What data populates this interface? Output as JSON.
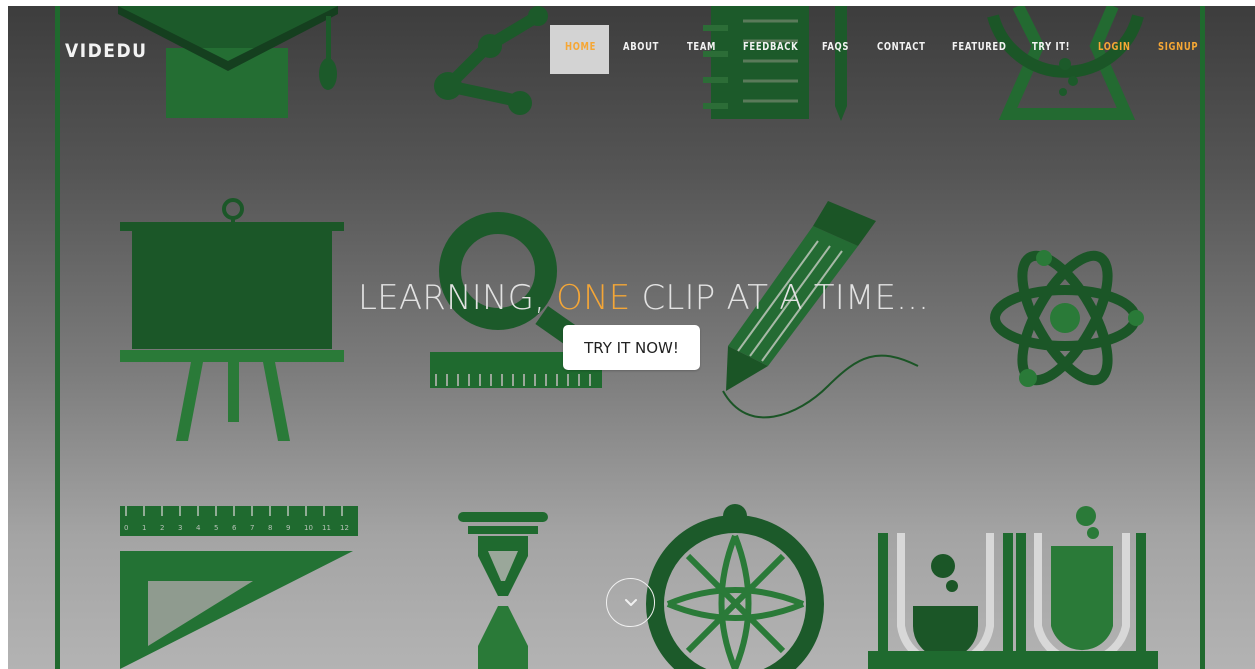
{
  "brand": {
    "name": "VIDEDU"
  },
  "nav": {
    "items": [
      {
        "label": "HOME",
        "active": true
      },
      {
        "label": "ABOUT"
      },
      {
        "label": "TEAM"
      },
      {
        "label": "FEEDBACK"
      },
      {
        "label": "FAQS"
      },
      {
        "label": "CONTACT"
      },
      {
        "label": "FEATURED"
      },
      {
        "label": "TRY IT!"
      },
      {
        "label": "LOGIN",
        "accent": true
      },
      {
        "label": "SIGNUP",
        "accent": true
      }
    ]
  },
  "hero": {
    "headline_pre": "LEARNING, ",
    "headline_highlight": "ONE",
    "headline_post": " CLIP AT A TIME...",
    "cta_label": "TRY IT NOW!",
    "scroll_icon": "chevron-down-icon"
  },
  "ruler": {
    "numbers": [
      "0",
      "1",
      "2",
      "3",
      "4",
      "5",
      "6",
      "7",
      "8",
      "9",
      "10",
      "11",
      "12"
    ]
  },
  "colors": {
    "accent": "#f6a735",
    "icon_green": "#1d5e2c",
    "icon_green_light": "#2c7a3a",
    "text_light": "#f2f2f2"
  }
}
